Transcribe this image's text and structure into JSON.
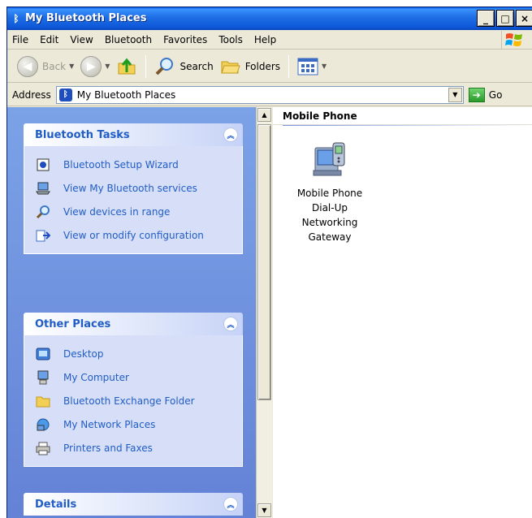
{
  "window": {
    "title": "My Bluetooth Places",
    "controls": [
      "_",
      "□",
      "×"
    ]
  },
  "menu": {
    "items": [
      "File",
      "Edit",
      "View",
      "Bluetooth",
      "Favorites",
      "Tools",
      "Help"
    ]
  },
  "toolbar": {
    "back_label": "Back",
    "search_label": "Search",
    "folders_label": "Folders"
  },
  "address": {
    "label": "Address",
    "value": "My Bluetooth Places",
    "go_label": "Go"
  },
  "taskpane": {
    "bluetooth_tasks": {
      "title": "Bluetooth Tasks",
      "items": [
        {
          "label": "Bluetooth Setup Wizard",
          "icon": "wizard-icon"
        },
        {
          "label": "View My Bluetooth services",
          "icon": "services-icon"
        },
        {
          "label": "View devices in range",
          "icon": "magnifier-icon"
        },
        {
          "label": "View or modify configuration",
          "icon": "configuration-icon"
        }
      ]
    },
    "other_places": {
      "title": "Other Places",
      "items": [
        {
          "label": "Desktop",
          "icon": "desktop-icon"
        },
        {
          "label": "My Computer",
          "icon": "computer-icon"
        },
        {
          "label": "Bluetooth Exchange Folder",
          "icon": "folder-icon"
        },
        {
          "label": "My Network Places",
          "icon": "network-icon"
        },
        {
          "label": "Printers and Faxes",
          "icon": "printer-icon"
        }
      ]
    },
    "details": {
      "title": "Details"
    }
  },
  "content": {
    "group_title": "Mobile Phone",
    "device": {
      "label_lines": [
        "Mobile Phone",
        "Dial-Up",
        "Networking",
        "Gateway"
      ],
      "icon": "mobile-phone-icon"
    }
  },
  "colors": {
    "titlebar": "#0d57d8",
    "taskpane_bg": "#6f93e0",
    "panel_body": "#d6dff7",
    "link": "#215dc6"
  }
}
